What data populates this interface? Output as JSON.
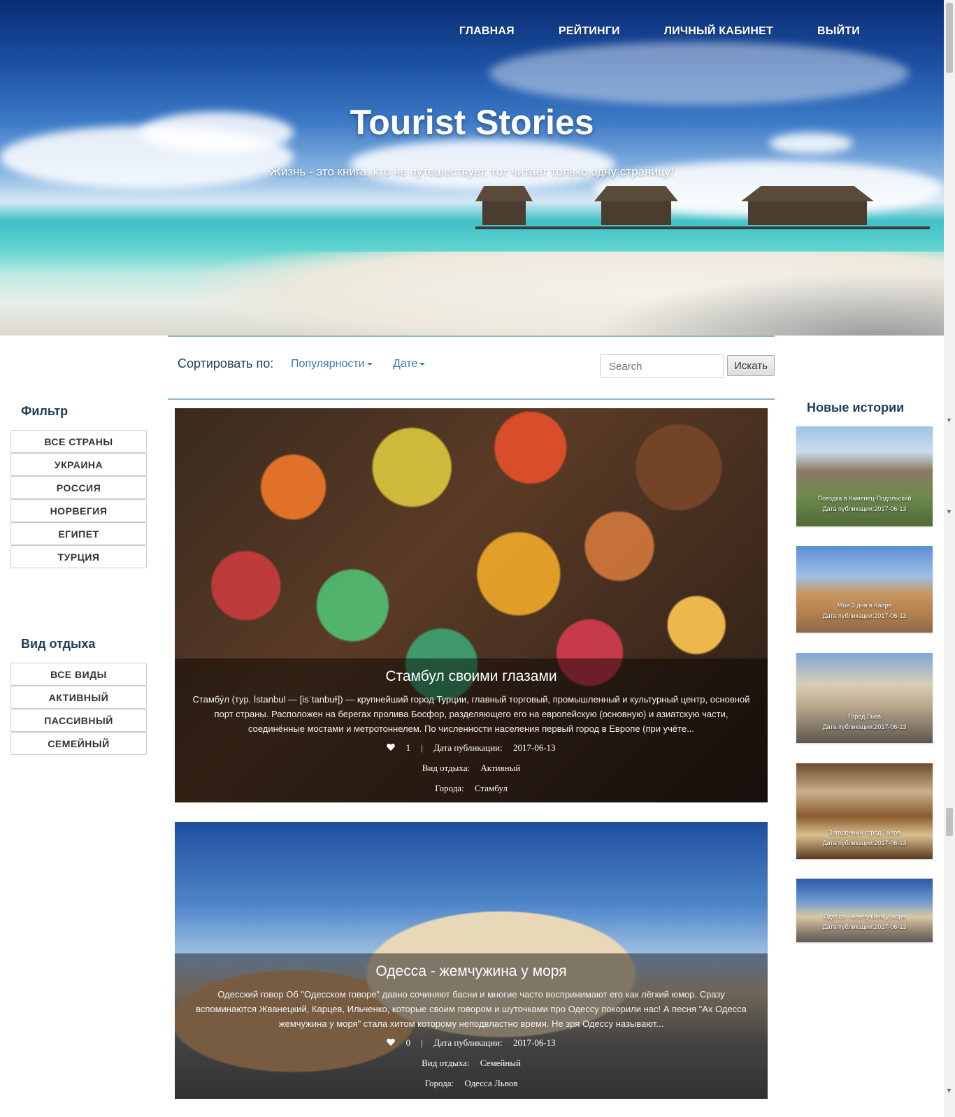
{
  "nav": [
    "ГЛАВНАЯ",
    "РЕЙТИНГИ",
    "ЛИЧНЫЙ КАБИНЕТ",
    "ВЫЙТИ"
  ],
  "hero": {
    "title": "Tourist Stories",
    "subtitle": "Жизнь - это книга, кто не путешествует, тот читает только одну страницу!"
  },
  "sort": {
    "label": "Сортировать по:",
    "options": [
      "Популярности",
      "Дате"
    ],
    "search_placeholder": "Search",
    "search_button": "Искать"
  },
  "filters": {
    "title": "Фильтр",
    "countries": [
      "ВСЕ СТРАНЫ",
      "УКРАИНА",
      "РОССИЯ",
      "НОРВЕГИЯ",
      "ЕГИПЕТ",
      "ТУРЦИЯ"
    ]
  },
  "rest_types": {
    "title": "Вид отдыха",
    "items": [
      "ВСЕ ВИДЫ",
      "АКТИВНЫЙ",
      "ПАССИВНЫЙ",
      "СЕМЕЙНЫЙ"
    ]
  },
  "stories": [
    {
      "title": "Стамбул своими глазами",
      "text": "Стамбу́л (тур. İstanbul — [isˈtanbuɫ]) — крупнейший город Турции, главный торговый, промышленный и культурный центр, основной порт страны. Расположен на берегах пролива Босфор, разделяющего его на европейскую (основную) и азиатскую части, соединённые мостами и метротоннелем. По численности населения первый город в Европе (при учёте...",
      "likes": "1",
      "sep": "|",
      "date_label": "Дата публикации:",
      "date": "2017-06-13",
      "type_label": "Вид отдыха:",
      "type": "Активный",
      "city_label": "Города:",
      "cities": "Стамбул"
    },
    {
      "title": "Одесса - жемчужина у моря",
      "text": "Одесский говор Об \"Одесском говоре\" давно сочиняют басни и многие часто воспринимают его как лёгкий юмор. Сразу вспоминаются Жванецкий, Карцев, Ильченко, которые своим говором и шуточками про Одессу покорили нас! А песня \"Ах Одесса жемчужина у моря\" стала хитом которому неподвластно время. Не зря Одессу называют...",
      "likes": "0",
      "sep": "|",
      "date_label": "Дата публикации:",
      "date": "2017-06-13",
      "type_label": "Вид отдыха:",
      "type": "Семейный",
      "city_label": "Города:",
      "cities": "Одесса Львов"
    }
  ],
  "new_stories": {
    "title": "Новые истории",
    "items": [
      {
        "title": "Поездка в Каменец-Подольский",
        "date": "Дата публикации:2017-06-13"
      },
      {
        "title": "Мои 3 дня в Каире",
        "date": "Дата публикации:2017-06-13"
      },
      {
        "title": "Город Льва",
        "date": "Дата публикации:2017-06-13"
      },
      {
        "title": "Загадочный город Львов",
        "date": "Дата публикации:2017-06-13"
      },
      {
        "title": "Одесса - жемчужина у моря",
        "date": "Дата публикации:2017-06-13"
      }
    ]
  }
}
